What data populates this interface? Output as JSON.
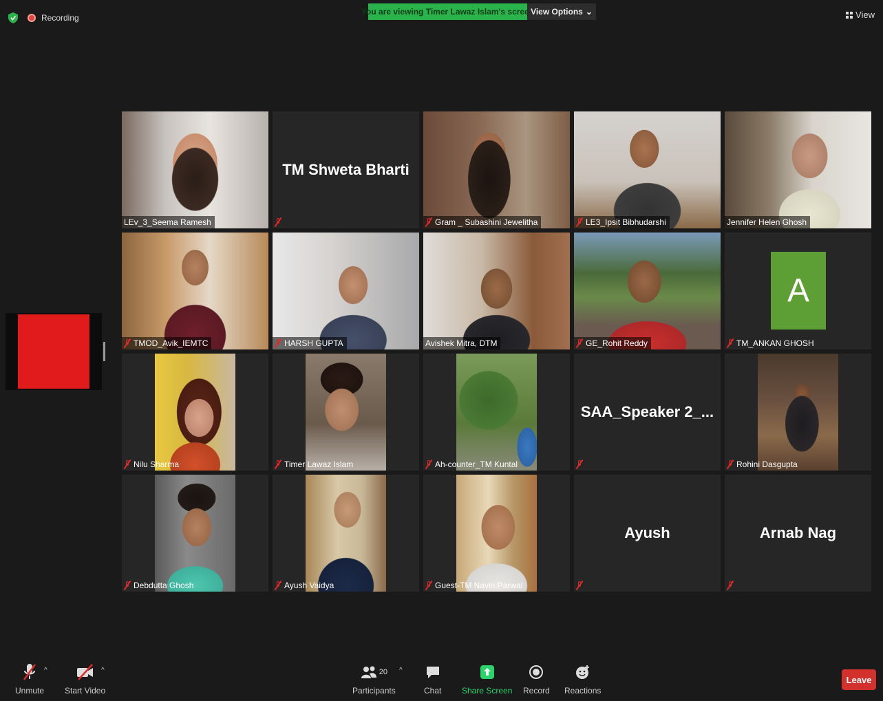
{
  "topbar": {
    "recording_label": "Recording",
    "banner_text": "You are viewing Timer Lawaz Islam's screen",
    "view_options_label": "View Options",
    "view_label": "View"
  },
  "participants": [
    {
      "name": "LEv_3_Seema Ramesh",
      "muted": false,
      "video": true
    },
    {
      "name": "TM Shweta Bharti",
      "muted": true,
      "video": false
    },
    {
      "name": "Gram _ Subashini Jewelitha",
      "muted": true,
      "video": true
    },
    {
      "name": "LE3_Ipsit Bibhudarshi",
      "muted": true,
      "video": true
    },
    {
      "name": "Jennifer Helen Ghosh",
      "muted": false,
      "video": true,
      "active_speaker": true
    },
    {
      "name": "TMOD_Avik_IEMTC",
      "muted": true,
      "video": true
    },
    {
      "name": "HARSH GUPTA",
      "muted": true,
      "video": true
    },
    {
      "name": "Avishek Mitra, DTM",
      "muted": false,
      "video": true
    },
    {
      "name": "GE_Rohit Reddy",
      "muted": true,
      "video": true
    },
    {
      "name": "TM_ANKAN GHOSH",
      "muted": true,
      "video": false,
      "avatar_letter": "A"
    },
    {
      "name": "Nilu Sharma",
      "muted": true,
      "video": true
    },
    {
      "name": "Timer Lawaz Islam",
      "muted": true,
      "video": true
    },
    {
      "name": "Ah-counter_TM Kuntal",
      "muted": true,
      "video": true
    },
    {
      "name": "SAA_Speaker 2_...",
      "muted": true,
      "video": false
    },
    {
      "name": "Rohini Dasgupta",
      "muted": true,
      "video": true
    },
    {
      "name": "Debdutta Ghosh",
      "muted": true,
      "video": true
    },
    {
      "name": "Ayush Vaidya",
      "muted": true,
      "video": true
    },
    {
      "name": "Guest-TM Navin Parwal",
      "muted": true,
      "video": true
    },
    {
      "name": "Ayush",
      "muted": true,
      "video": false
    },
    {
      "name": "Arnab Nag",
      "muted": true,
      "video": false
    }
  ],
  "toolbar": {
    "unmute": "Unmute",
    "start_video": "Start Video",
    "participants_label": "Participants",
    "participants_count": "20",
    "chat": "Chat",
    "share_screen": "Share Screen",
    "record": "Record",
    "reactions": "Reactions",
    "leave": "Leave"
  },
  "icons": [
    "shield-icon",
    "recording-icon",
    "grid-icon",
    "microphone-muted-icon",
    "video-off-icon",
    "participants-icon",
    "chat-icon",
    "share-screen-icon",
    "record-icon",
    "reactions-icon"
  ],
  "colors": {
    "banner": "#2bb34b",
    "leave": "#d3312b",
    "active_speaker": "#c3e38a",
    "avatar": "#5d9f34",
    "mute": "#e02a2a"
  }
}
